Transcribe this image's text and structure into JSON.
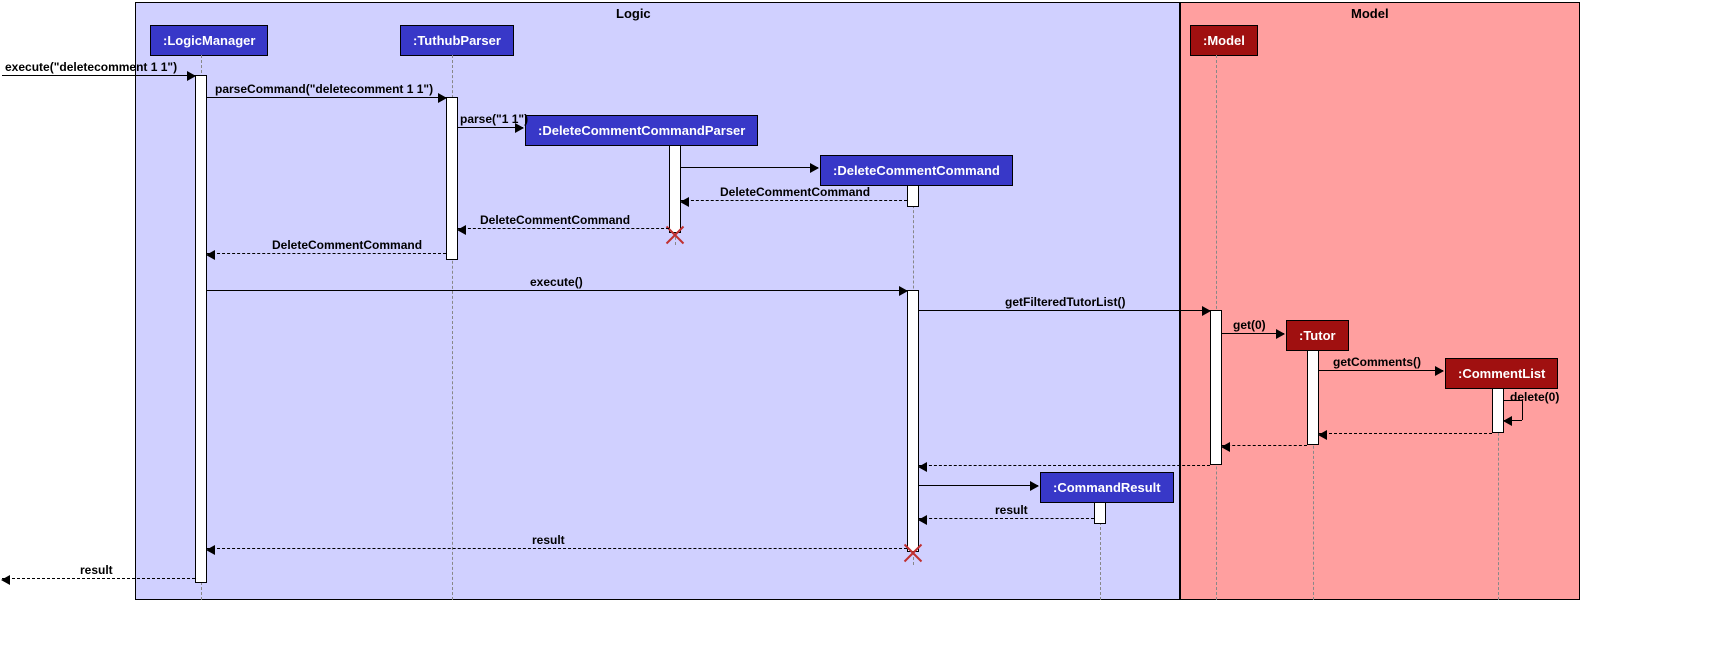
{
  "regions": {
    "logic": {
      "label": "Logic"
    },
    "model": {
      "label": "Model"
    }
  },
  "lifelines": {
    "logicManager": ":LogicManager",
    "tuthubParser": ":TuthubParser",
    "dccParser": ":DeleteCommentCommandParser",
    "dcc": ":DeleteCommentCommand",
    "modelObj": ":Model",
    "tutor": ":Tutor",
    "commentList": ":CommentList",
    "commandResult": ":CommandResult"
  },
  "messages": {
    "executeDeleteComment": "execute(\"deletecomment 1 1\")",
    "parseCommand": "parseCommand(\"deletecomment 1 1\")",
    "parse": "parse(\"1 1\")",
    "returnDCC1": "DeleteCommentCommand",
    "returnDCC2": "DeleteCommentCommand",
    "returnDCC3": "DeleteCommentCommand",
    "executeOnDCC": "execute()",
    "getFilteredTutorList": "getFilteredTutorList()",
    "getZero": "get(0)",
    "getComments": "getComments()",
    "deleteZero": "delete(0)",
    "resultReturn": "result"
  }
}
